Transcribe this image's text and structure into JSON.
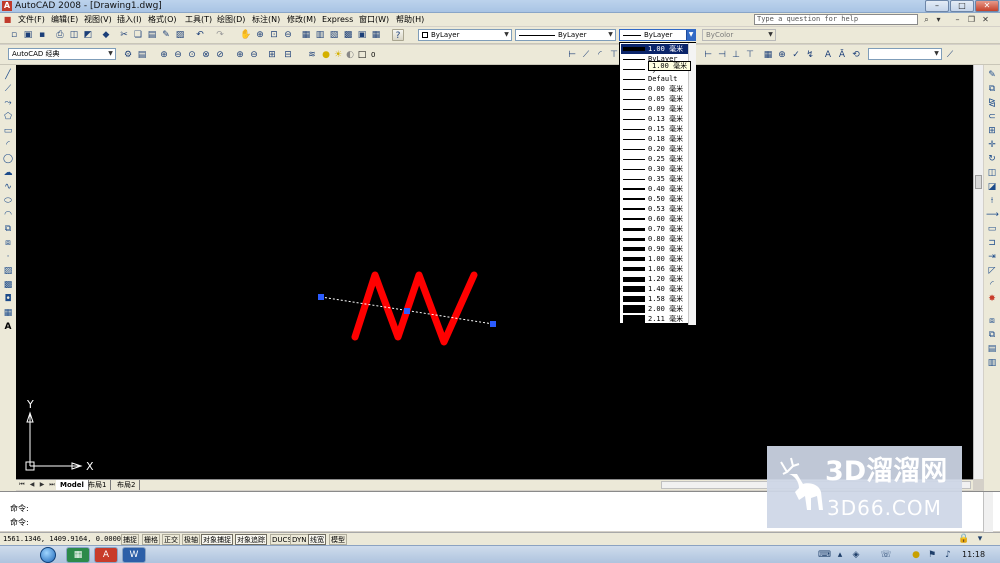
{
  "window": {
    "title": "AutoCAD 2008 - [Drawing1.dwg]",
    "minimize_label": "–",
    "maximize_label": "□",
    "close_label": "✕"
  },
  "menu": {
    "items": [
      "文件(F)",
      "编辑(E)",
      "视图(V)",
      "插入(I)",
      "格式(O)",
      "工具(T)",
      "绘图(D)",
      "标注(N)",
      "修改(M)",
      "Express",
      "窗口(W)",
      "帮助(H)"
    ],
    "help_search_placeholder": "Type a question for help"
  },
  "toolbar": {
    "workspace": "AutoCAD 经典",
    "layer": "0",
    "color_combo": "ByLayer",
    "linetype_combo": "ByLayer",
    "lineweight_combo": "ByLayer",
    "plotstyle_combo": "ByColor"
  },
  "lineweight_dropdown": {
    "tooltip": "1.00 毫米",
    "items": [
      {
        "label": "1.00 毫米",
        "mm": 1.0,
        "selected": true
      },
      {
        "label": "ByLayer",
        "mm": 0.1
      },
      {
        "label": "ByBlock",
        "mm": 0.1
      },
      {
        "label": "Default",
        "mm": 0
      },
      {
        "label": "0.00 毫米",
        "mm": 0.0
      },
      {
        "label": "0.05 毫米",
        "mm": 0.05
      },
      {
        "label": "0.09 毫米",
        "mm": 0.09
      },
      {
        "label": "0.13 毫米",
        "mm": 0.13
      },
      {
        "label": "0.15 毫米",
        "mm": 0.15
      },
      {
        "label": "0.18 毫米",
        "mm": 0.18
      },
      {
        "label": "0.20 毫米",
        "mm": 0.2
      },
      {
        "label": "0.25 毫米",
        "mm": 0.25
      },
      {
        "label": "0.30 毫米",
        "mm": 0.3
      },
      {
        "label": "0.35 毫米",
        "mm": 0.35
      },
      {
        "label": "0.40 毫米",
        "mm": 0.4
      },
      {
        "label": "0.50 毫米",
        "mm": 0.5
      },
      {
        "label": "0.53 毫米",
        "mm": 0.53
      },
      {
        "label": "0.60 毫米",
        "mm": 0.6
      },
      {
        "label": "0.70 毫米",
        "mm": 0.7
      },
      {
        "label": "0.80 毫米",
        "mm": 0.8
      },
      {
        "label": "0.90 毫米",
        "mm": 0.9
      },
      {
        "label": "1.00 毫米",
        "mm": 1.0
      },
      {
        "label": "1.06 毫米",
        "mm": 1.06
      },
      {
        "label": "1.20 毫米",
        "mm": 1.2
      },
      {
        "label": "1.40 毫米",
        "mm": 1.4
      },
      {
        "label": "1.58 毫米",
        "mm": 1.58
      },
      {
        "label": "2.00 毫米",
        "mm": 2.0
      },
      {
        "label": "2.11 毫米",
        "mm": 2.11
      }
    ]
  },
  "canvas": {
    "background": "#000000",
    "polyline_color": "#ff0000",
    "ucs_x_label": "X",
    "ucs_y_label": "Y"
  },
  "layout_tabs": [
    "Model",
    "布局1",
    "布局2"
  ],
  "command": {
    "line1": "命令:",
    "line2": "命令:"
  },
  "status": {
    "coordinates": "1561.1346, 1409.9164, 0.0000",
    "toggles": [
      "捕捉",
      "栅格",
      "正交",
      "极轴",
      "对象捕捉",
      "对象追踪",
      "DUCS",
      "DYN",
      "线宽",
      "模型"
    ]
  },
  "taskbar": {
    "clock": "11:18"
  },
  "watermark": {
    "brand": "3D溜溜网",
    "domain": "3D66.COM"
  }
}
